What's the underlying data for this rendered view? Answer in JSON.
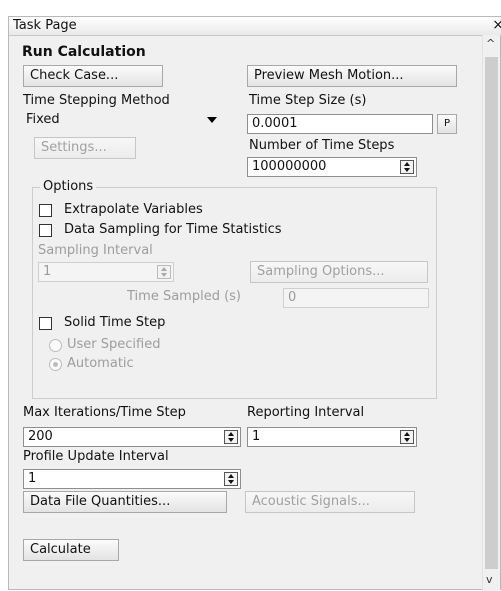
{
  "window": {
    "title": "Task Page",
    "close_glyph": "×"
  },
  "heading": "Run Calculation",
  "buttons": {
    "check_case": "Check Case...",
    "preview_mesh_motion": "Preview Mesh Motion...",
    "settings": "Settings...",
    "sampling_options": "Sampling Options...",
    "data_file_quantities": "Data File Quantities...",
    "acoustic_signals": "Acoustic Signals...",
    "calculate": "Calculate"
  },
  "time_stepping": {
    "label": "Time Stepping Method",
    "value": "Fixed"
  },
  "time_step_size": {
    "label": "Time Step Size (s)",
    "value": "0.0001",
    "param_button": "P"
  },
  "number_of_time_steps": {
    "label": "Number of Time Steps",
    "value": "100000000"
  },
  "options": {
    "title": "Options",
    "extrapolate_variables": {
      "label": "Extrapolate Variables",
      "checked": false
    },
    "data_sampling": {
      "label": "Data Sampling for Time Statistics",
      "checked": false
    },
    "sampling_interval": {
      "label": "Sampling Interval",
      "value": "1"
    },
    "time_sampled": {
      "label": "Time Sampled (s)",
      "value": "0"
    },
    "solid_time_step": {
      "label": "Solid Time Step",
      "checked": false
    },
    "user_specified": {
      "label": "User Specified",
      "selected": false
    },
    "automatic": {
      "label": "Automatic",
      "selected": true
    }
  },
  "max_iterations": {
    "label": "Max Iterations/Time Step",
    "value": "200"
  },
  "reporting_interval": {
    "label": "Reporting Interval",
    "value": "1"
  },
  "profile_update_interval": {
    "label": "Profile Update Interval",
    "value": "1"
  },
  "scrollbar": {
    "up_glyph": "^",
    "down_glyph": "v"
  }
}
